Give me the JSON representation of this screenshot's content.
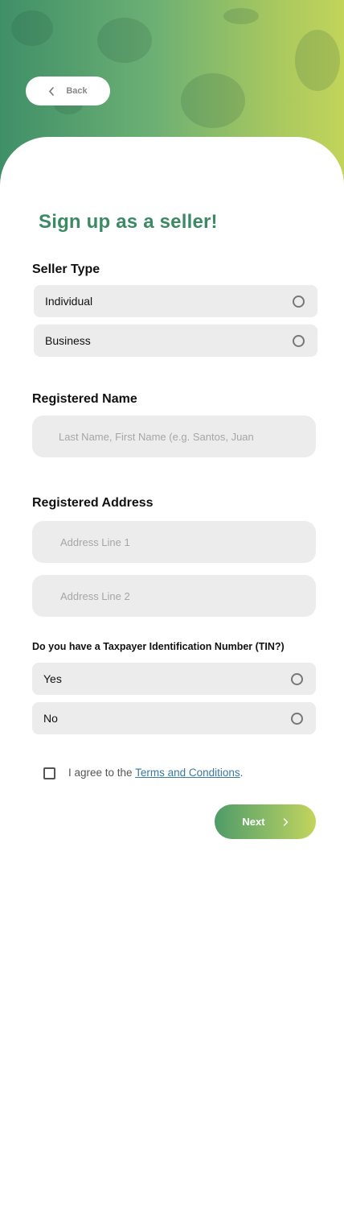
{
  "header": {
    "back_label": "Back",
    "back_icon": "chevron-left-icon",
    "gradient": [
      "#3f8f68",
      "#c2d45a"
    ]
  },
  "form": {
    "title": "Sign up as a seller!",
    "seller_type": {
      "label": "Seller Type",
      "options": [
        {
          "label": "Individual",
          "selected": false
        },
        {
          "label": "Business",
          "selected": false
        }
      ]
    },
    "registered_name": {
      "label": "Registered Name",
      "placeholder": "Last Name, First Name (e.g. Santos, Juan",
      "value": ""
    },
    "registered_address": {
      "label": "Registered Address",
      "line1_placeholder": "Address Line 1",
      "line2_placeholder": "Address Line 2"
    },
    "tin": {
      "label": "Do you have a Taxpayer Identification Number (TIN?)",
      "options": [
        {
          "label": "Yes",
          "selected": false
        },
        {
          "label": "No",
          "selected": false
        }
      ]
    },
    "terms": {
      "checked": false,
      "prefix": "I agree to the ",
      "link": "Terms and Conditions",
      "suffix": "."
    },
    "next_label": "Next",
    "next_icon": "chevron-right-icon"
  },
  "colors": {
    "title": "#3c8a64",
    "field_bg": "#ececec",
    "link": "#3a78a6"
  }
}
